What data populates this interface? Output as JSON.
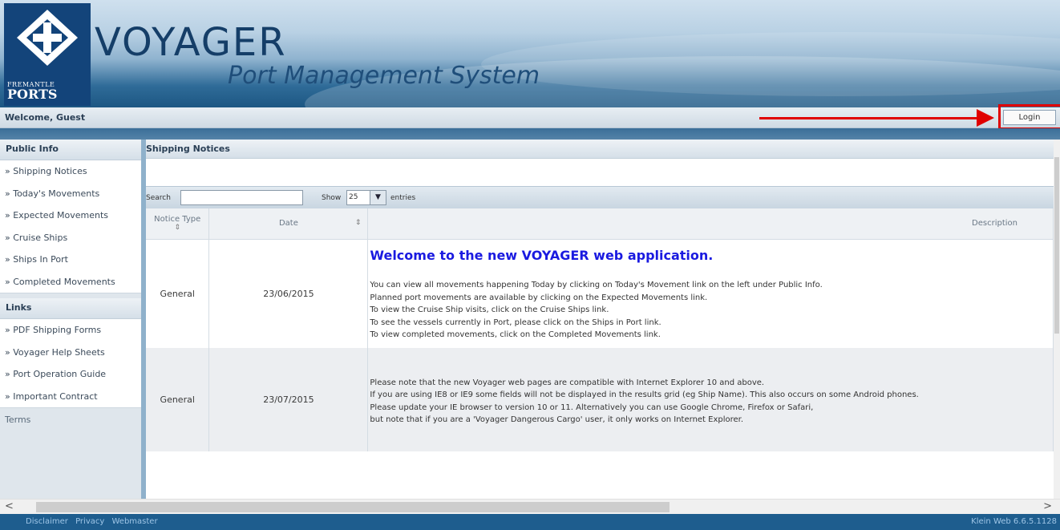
{
  "header": {
    "logo_line1": "FREMANTLE",
    "logo_line2": "PORTS",
    "title": "VOYAGER",
    "subtitle": "Port Management System"
  },
  "welcome": {
    "text": "Welcome, Guest",
    "login_label": "Login"
  },
  "sidebar": {
    "public_info": {
      "heading": "Public Info",
      "items": [
        "» Shipping Notices",
        "» Today's Movements",
        "» Expected Movements",
        "» Cruise Ships",
        "» Ships In Port",
        "» Completed Movements"
      ]
    },
    "links": {
      "heading": "Links",
      "items": [
        "» PDF Shipping Forms",
        "» Voyager Help Sheets",
        "» Port Operation Guide",
        "» Important Contract"
      ]
    },
    "terms": "Terms"
  },
  "main": {
    "heading": "Shipping Notices",
    "search_label": "Search",
    "search_value": "",
    "show_label": "Show",
    "show_value": "25",
    "entries_label": "entries",
    "columns": {
      "type": "Notice Type",
      "date": "Date",
      "description": "Description"
    },
    "rows": [
      {
        "type": "General",
        "date": "23/06/2015",
        "headline": "Welcome to the new VOYAGER web application.",
        "lines": [
          "You can view all movements happening Today by clicking on Today's Movement link on the left under Public Info.",
          "Planned port movements are available by clicking on the Expected Movements link.",
          "To view the Cruise Ship visits, click on the Cruise Ships link.",
          "To see the vessels currently in Port, please click on the Ships in Port link.",
          "To view completed movements, click on the Completed Movements link."
        ]
      },
      {
        "type": "General",
        "date": "23/07/2015",
        "headline": "",
        "lines": [
          "Please note that the new Voyager web pages are compatible with Internet Explorer 10 and above.",
          "If you are using IE8 or IE9 some fields will not be displayed in the results grid (eg Ship Name). This also occurs on some Android phones.",
          "Please update your IE browser to version 10 or 11. Alternatively you can use Google Chrome, Firefox or Safari,",
          "but note that if you are a 'Voyager Dangerous Cargo' user, it only works on Internet Explorer."
        ]
      }
    ]
  },
  "footer": {
    "links": [
      "Disclaimer",
      "Privacy",
      "Webmaster"
    ],
    "version": "Klein Web  6.6.5.1128"
  },
  "colors": {
    "header_dark": "#1d5783",
    "footer": "#1e5d8e",
    "highlight": "#e00000",
    "headline": "#1a1ae0"
  }
}
